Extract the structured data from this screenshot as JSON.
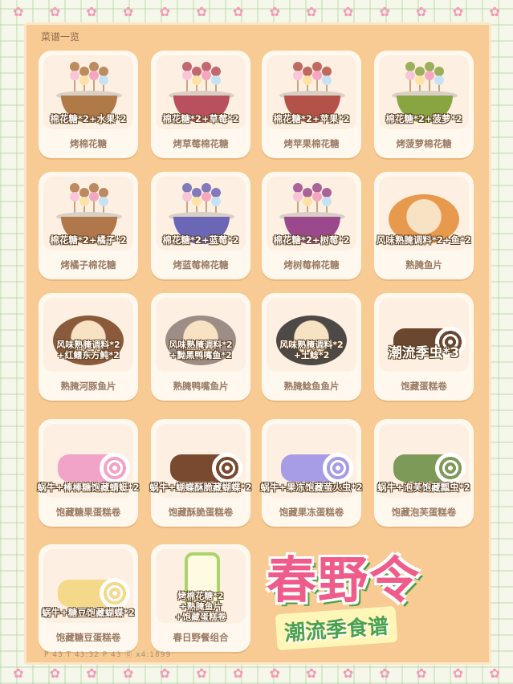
{
  "panel_title": "菜谱一览",
  "recipes": [
    {
      "name": "烤棉花糖",
      "ingredients": "棉花糖*2+水果*2",
      "style": "pot",
      "color": "#b07a48"
    },
    {
      "name": "烤草莓棉花糖",
      "ingredients": "棉花糖*2+草莓*2",
      "style": "pot",
      "color": "#b9505e"
    },
    {
      "name": "烤苹果棉花糖",
      "ingredients": "棉花糖*2+苹果*2",
      "style": "pot",
      "color": "#b4524a"
    },
    {
      "name": "烤菠萝棉花糖",
      "ingredients": "棉花糖*2+菠萝*2",
      "style": "pot",
      "color": "#88a542"
    },
    {
      "name": "烤橘子棉花糖",
      "ingredients": "棉花糖*2+橘子*2",
      "style": "pot",
      "color": "#b0784a"
    },
    {
      "name": "烤蓝莓棉花糖",
      "ingredients": "棉花糖*2+蓝莓*2",
      "style": "pot",
      "color": "#6b66b5"
    },
    {
      "name": "烤树莓棉花糖",
      "ingredients": "棉花糖*2+树莓*2",
      "style": "pot",
      "color": "#9a4a8c"
    },
    {
      "name": "熟腌鱼片",
      "ingredients": "风味熟腌调料*2+鱼*2",
      "style": "plate",
      "color": "#e79a4d"
    },
    {
      "name": "熟腌河豚鱼片",
      "ingredients": "风味熟腌调料*2\n+红鳍东方鲀*2",
      "style": "plate",
      "color": "#8a5a3a"
    },
    {
      "name": "熟腌鸭嘴鱼片",
      "ingredients": "风味熟腌调料*2\n+黝黑鸭嘴鱼*2",
      "style": "plate",
      "color": "#9c8d86"
    },
    {
      "name": "熟腌鲶鱼鱼片",
      "ingredients": "风味熟腌调料*2\n+土鲶*2",
      "style": "plate",
      "color": "#4d4946"
    },
    {
      "name": "饱藏蛋糕卷",
      "ingredients": "潮流季虫*3",
      "style": "roll",
      "color": "#6b4730"
    },
    {
      "name": "饱藏糖果蛋糕卷",
      "ingredients": "蜗牛+棒棒糖饱藏蜻蜓*2",
      "style": "roll",
      "color": "#f2a3c8"
    },
    {
      "name": "饱藏酥脆蛋糕卷",
      "ingredients": "蜗牛+蝴蝶酥脆藏蝴蝶*2",
      "style": "roll",
      "color": "#7a4a30"
    },
    {
      "name": "饱藏果冻蛋糕卷",
      "ingredients": "蜗牛+果冻饱藏萤火虫*2",
      "style": "roll",
      "color": "#a79ce6"
    },
    {
      "name": "饱藏泡芙蛋糕卷",
      "ingredients": "蜗牛+泡芙饱藏瓢虫*2",
      "style": "roll",
      "color": "#7d9a58"
    },
    {
      "name": "饱藏糖豆蛋糕卷",
      "ingredients": "蜗牛+糖豆饱藏蝴蝶*2",
      "style": "roll",
      "color": "#f5d98a"
    },
    {
      "name": "春日野餐组合",
      "ingredients": "烤棉花糖*2\n+熟腌鱼片\n+饱藏蛋糕卷",
      "style": "basket",
      "color": "#a9d46a"
    }
  ],
  "banner": {
    "title": "春野令",
    "subtitle": "潮流季食谱"
  },
  "footer": "P 43  T 43:32  P 43  ⓪ x4:1899"
}
